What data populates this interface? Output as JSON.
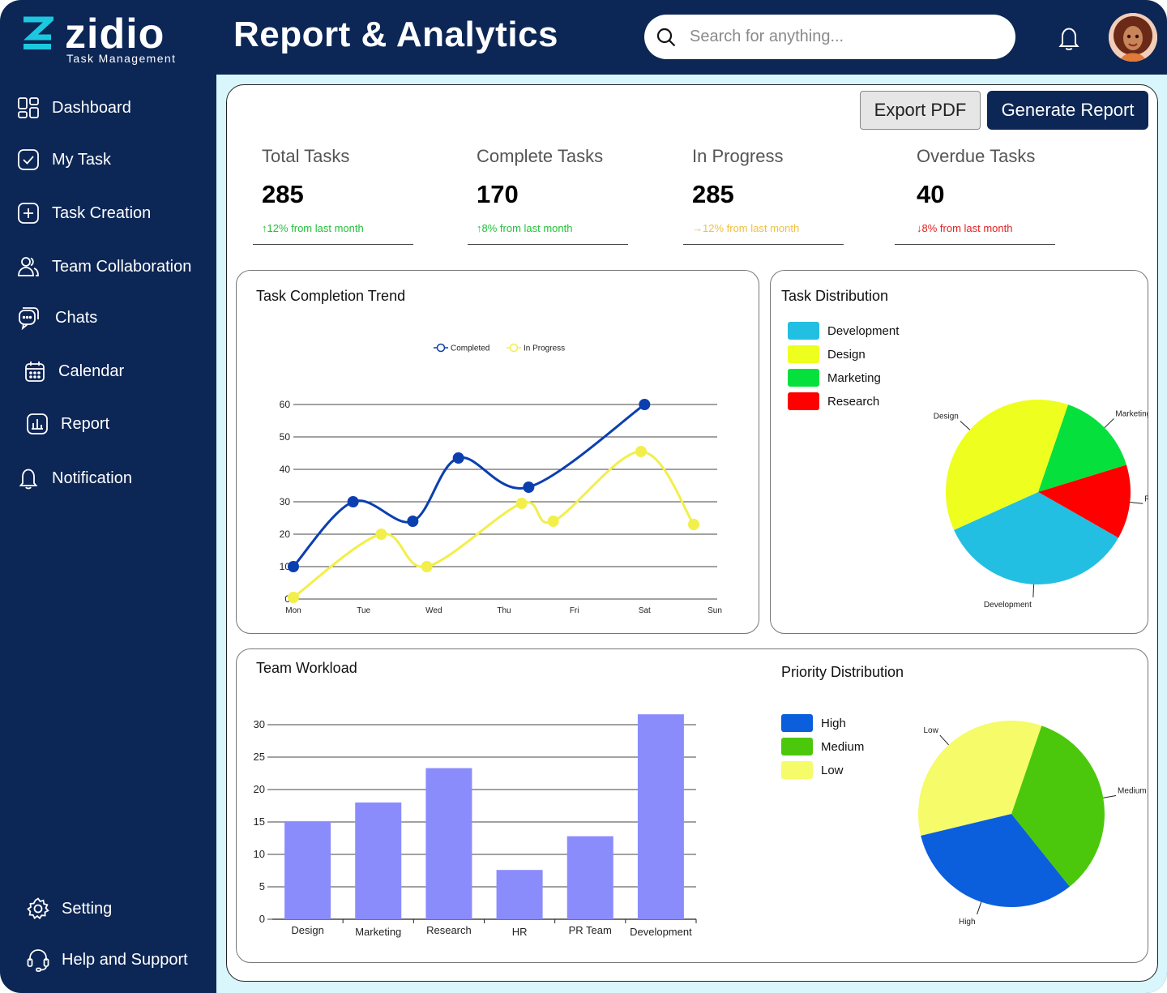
{
  "brand": {
    "name": "zidio",
    "tagline": "Task Management",
    "accent": "#1cc8e0"
  },
  "header": {
    "title": "Report & Analytics",
    "search_placeholder": "Search for anything..."
  },
  "sidebar": {
    "items": [
      {
        "label": "Dashboard",
        "icon": "grid-icon"
      },
      {
        "label": "My Task",
        "icon": "check-square-icon"
      },
      {
        "label": "Task Creation",
        "icon": "plus-square-icon"
      },
      {
        "label": "Team Collaboration",
        "icon": "users-icon"
      },
      {
        "label": "Chats",
        "icon": "chat-icon"
      },
      {
        "label": "Calendar",
        "icon": "calendar-icon"
      },
      {
        "label": "Report",
        "icon": "report-icon"
      },
      {
        "label": "Notification",
        "icon": "bell-icon"
      }
    ],
    "footer": [
      {
        "label": "Setting",
        "icon": "gear-icon"
      },
      {
        "label": "Help and Support",
        "icon": "headset-icon"
      }
    ]
  },
  "toolbar": {
    "export_label": "Export PDF",
    "generate_label": "Generate Report"
  },
  "stats": [
    {
      "label": "Total Tasks",
      "value": "285",
      "change": "12% from last month",
      "arrow": "↑",
      "color": "#22c03a"
    },
    {
      "label": "Complete Tasks",
      "value": "170",
      "change": "8% from last month",
      "arrow": "↑",
      "color": "#22c03a"
    },
    {
      "label": "In Progress",
      "value": "285",
      "change": "12% from last month",
      "arrow": "→",
      "color": "#f0c040"
    },
    {
      "label": "Overdue Tasks",
      "value": "40",
      "change": "8% from last month",
      "arrow": "↓",
      "color": "#e02020"
    }
  ],
  "cards": {
    "trend_title": "Task Completion Trend",
    "distribution_title": "Task Distribution",
    "workload_title": "Team Workload",
    "priority_title": "Priority Distribution"
  },
  "chart_data": [
    {
      "type": "line",
      "title": "Task Completion Trend",
      "categories": [
        "Mon",
        "Tue",
        "Wed",
        "Thu",
        "Fri",
        "Sat",
        "Sun"
      ],
      "ylim": [
        0,
        60
      ],
      "yticks": [
        0,
        10,
        20,
        30,
        40,
        50,
        60
      ],
      "legend": "top-center",
      "series": [
        {
          "name": "Completed",
          "color": "#0b3fb0",
          "points": [
            [
              0,
              10
            ],
            [
              0.85,
              30
            ],
            [
              1.7,
              24
            ],
            [
              2.35,
              43.5
            ],
            [
              3.35,
              34.5
            ],
            [
              5.0,
              60
            ]
          ]
        },
        {
          "name": "In Progress",
          "color": "#f2ef4a",
          "points": [
            [
              0,
              0.5
            ],
            [
              1.25,
              20
            ],
            [
              1.9,
              10
            ],
            [
              3.25,
              29.5
            ],
            [
              3.7,
              24
            ],
            [
              4.95,
              45.5
            ],
            [
              5.7,
              23
            ]
          ]
        }
      ]
    },
    {
      "type": "pie",
      "title": "Task Distribution",
      "legend": "top-left",
      "slices": [
        {
          "label": "Marketing",
          "value": 15,
          "color": "#06e03c"
        },
        {
          "label": "Research",
          "value": 13,
          "color": "#ff0000"
        },
        {
          "label": "Development",
          "value": 35,
          "color": "#22bfe2"
        },
        {
          "label": "Design",
          "value": 37,
          "color": "#eefe1e"
        }
      ],
      "legend_order": [
        "Development",
        "Design",
        "Marketing",
        "Research"
      ]
    },
    {
      "type": "bar",
      "title": "Team Workload",
      "categories": [
        "Design",
        "Marketing",
        "Research",
        "HR",
        "PR Team",
        "Development"
      ],
      "values": [
        15,
        18,
        23.3,
        7.6,
        12.8,
        31.6
      ],
      "ylim": [
        0,
        30
      ],
      "yticks": [
        0,
        5,
        10,
        15,
        20,
        25,
        30
      ],
      "color": "#8a8cfc"
    },
    {
      "type": "pie",
      "title": "Priority Distribution",
      "legend": "top-left",
      "slices": [
        {
          "label": "Medium",
          "value": 34,
          "color": "#4cc80c"
        },
        {
          "label": "High",
          "value": 32,
          "color": "#0b5fdc"
        },
        {
          "label": "Low",
          "value": 34,
          "color": "#f6fb6a"
        }
      ],
      "legend_order": [
        "High",
        "Medium",
        "Low"
      ]
    }
  ]
}
